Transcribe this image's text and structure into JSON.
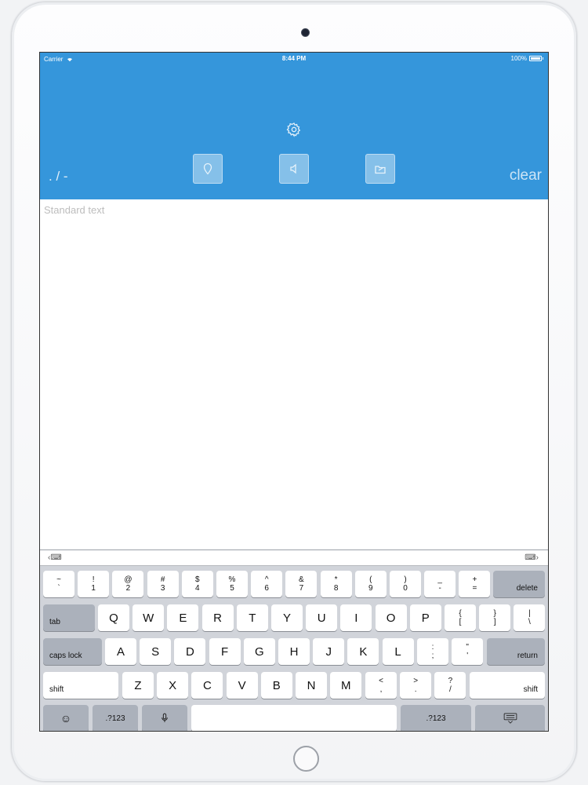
{
  "status_bar": {
    "carrier": "Carrier",
    "time": "8:44 PM",
    "battery": "100%"
  },
  "header": {
    "mode_label": ". / -",
    "clear_label": "clear",
    "buttons": [
      {
        "name": "location-pin-button",
        "icon": "location-pin-icon"
      },
      {
        "name": "speaker-button",
        "icon": "speaker-icon"
      },
      {
        "name": "share-button",
        "icon": "share-folder-icon"
      }
    ],
    "settings_icon": "gear-icon",
    "background_color": "#3596db"
  },
  "editor": {
    "placeholder": "Standard text",
    "value": ""
  },
  "keyboard": {
    "bar_left": "‹⌨",
    "bar_right": "⌨›",
    "row1": [
      {
        "top": "~",
        "bottom": "`"
      },
      {
        "top": "!",
        "bottom": "1"
      },
      {
        "top": "@",
        "bottom": "2"
      },
      {
        "top": "#",
        "bottom": "3"
      },
      {
        "top": "$",
        "bottom": "4"
      },
      {
        "top": "%",
        "bottom": "5"
      },
      {
        "top": "^",
        "bottom": "6"
      },
      {
        "top": "&",
        "bottom": "7"
      },
      {
        "top": "*",
        "bottom": "8"
      },
      {
        "top": "(",
        "bottom": "9"
      },
      {
        "top": ")",
        "bottom": "0"
      },
      {
        "top": "_",
        "bottom": "-"
      },
      {
        "top": "+",
        "bottom": "="
      }
    ],
    "delete_label": "delete",
    "tab_label": "tab",
    "row2": [
      "Q",
      "W",
      "E",
      "R",
      "T",
      "Y",
      "U",
      "I",
      "O",
      "P"
    ],
    "row2_dual": [
      {
        "top": "{",
        "bottom": "["
      },
      {
        "top": "}",
        "bottom": "]"
      },
      {
        "top": "|",
        "bottom": "\\"
      }
    ],
    "caps_label": "caps lock",
    "row3": [
      "A",
      "S",
      "D",
      "F",
      "G",
      "H",
      "J",
      "K",
      "L"
    ],
    "row3_dual": [
      {
        "top": ":",
        "bottom": ";"
      },
      {
        "top": "\"",
        "bottom": "'"
      }
    ],
    "return_label": "return",
    "shift_label": "shift",
    "row4": [
      "Z",
      "X",
      "C",
      "V",
      "B",
      "N",
      "M"
    ],
    "row4_dual": [
      {
        "top": "<",
        "bottom": ","
      },
      {
        "top": ">",
        "bottom": "."
      },
      {
        "top": "?",
        "bottom": "/"
      }
    ],
    "emoji_label": "☺",
    "num_label": ".?123",
    "mic_icon": "microphone-icon",
    "hide_keyboard_icon": "hide-keyboard-icon"
  }
}
